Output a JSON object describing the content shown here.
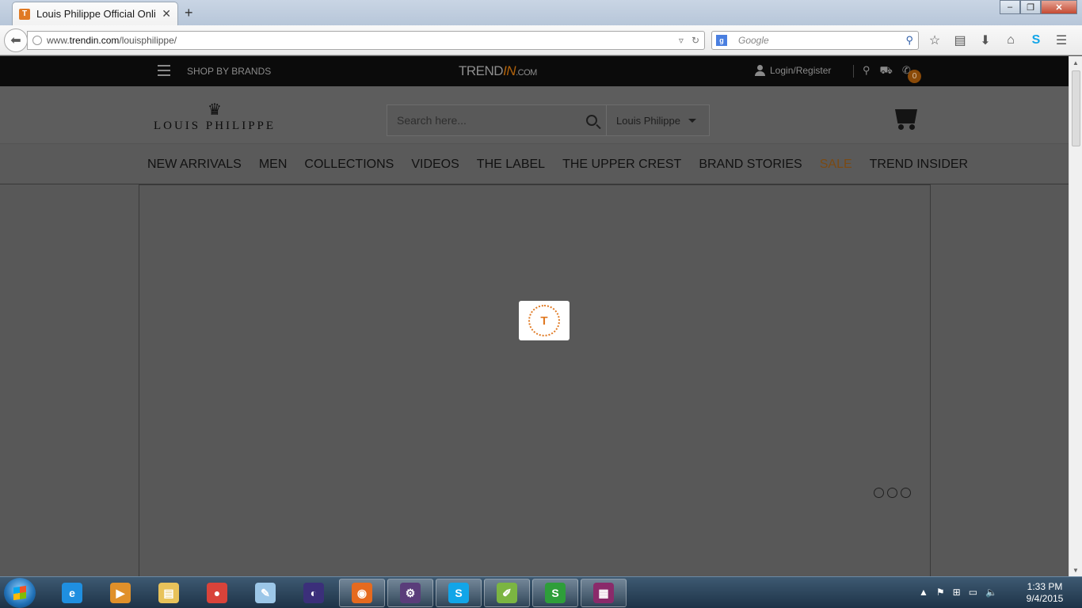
{
  "browser": {
    "tab_title": "Louis Philippe Official Onli...",
    "tab_favicon": "T",
    "url_prefix": "www.",
    "url_domain": "trendin.com",
    "url_path": "/louisphilippe/",
    "search_engine_icon": "g",
    "search_placeholder": "Google",
    "window_controls": {
      "minimize": "–",
      "maximize": "❐",
      "close": "✕"
    }
  },
  "site": {
    "topstrip": {
      "shop_by_brands": "SHOP BY BRANDS",
      "logo_trend": "TREND",
      "logo_in": "IN",
      "logo_com": ".COM",
      "login": "Login/Register"
    },
    "header": {
      "brand_name": "LOUIS PHILIPPE",
      "search_placeholder": "Search here...",
      "brand_select": "Louis Philippe",
      "cart_count": "0"
    },
    "menu": [
      "NEW ARRIVALS",
      "MEN",
      "COLLECTIONS",
      "VIDEOS",
      "THE LABEL",
      "THE UPPER CREST",
      "BRAND STORIES",
      "SALE",
      "TREND INSIDER"
    ],
    "loader_letter": "T",
    "carousel_dots": 3
  },
  "taskbar": {
    "clock_time": "1:33 PM",
    "clock_date": "9/4/2015",
    "apps": [
      {
        "name": "internet-explorer",
        "glyph": "e",
        "color": "#1f8fe0"
      },
      {
        "name": "media-player",
        "glyph": "▶",
        "color": "#e0902a"
      },
      {
        "name": "file-explorer",
        "glyph": "▤",
        "color": "#e8c25a"
      },
      {
        "name": "chrome",
        "glyph": "●",
        "color": "#d9433a"
      },
      {
        "name": "notepad",
        "glyph": "✎",
        "color": "#9cc7e8"
      },
      {
        "name": "eclipse",
        "glyph": "◐",
        "color": "#3b2f7a"
      },
      {
        "name": "firefox",
        "glyph": "◉",
        "color": "#e56a1f"
      },
      {
        "name": "eclipse-java-ee",
        "glyph": "⚙",
        "color": "#5a3d7a"
      },
      {
        "name": "skype",
        "glyph": "S",
        "color": "#12a5e8"
      },
      {
        "name": "notepad-plus",
        "glyph": "✐",
        "color": "#7bb542"
      },
      {
        "name": "sublime-green",
        "glyph": "S",
        "color": "#2e9e3a"
      },
      {
        "name": "winrar",
        "glyph": "▦",
        "color": "#8a2a6a"
      }
    ]
  }
}
